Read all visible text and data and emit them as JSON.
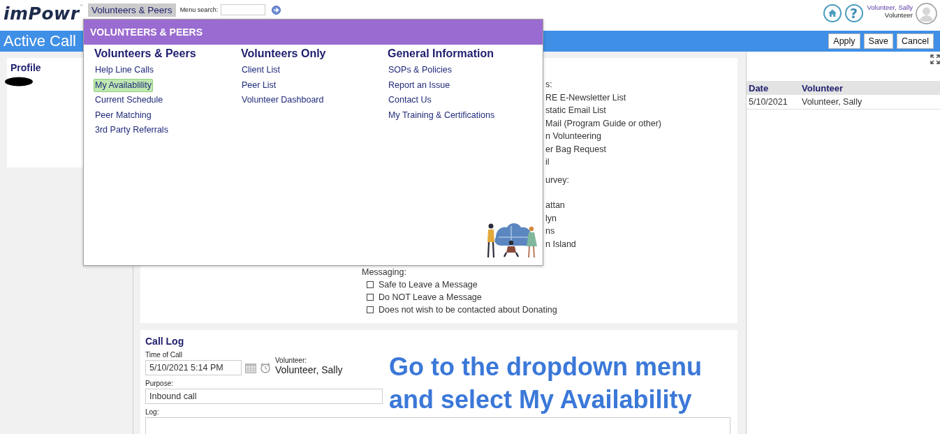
{
  "header": {
    "logo": "imPowr",
    "logo_mark": "™",
    "menu_tabs": [
      {
        "label": "Volunteers & Peers",
        "selected": true
      }
    ],
    "menu_search": {
      "label": "Menu search:"
    },
    "help": "?",
    "user": {
      "name": "Volunteer, Sally",
      "role": "Volunteer"
    }
  },
  "title_bar": {
    "title": "Active Call",
    "buttons": [
      "Apply",
      "Save",
      "Cancel"
    ]
  },
  "profile": {
    "title": "Profile"
  },
  "form": {
    "lines": [
      {
        "kind": "heading",
        "text": "s:"
      },
      {
        "kind": "option",
        "text": "RE E-Newsletter List"
      },
      {
        "kind": "option",
        "text": "static Email List"
      },
      {
        "kind": "option",
        "text": "Mail (Program Guide or other)"
      },
      {
        "kind": "option",
        "text": "n Volunteering"
      },
      {
        "kind": "option",
        "text": "er Bag Request"
      },
      {
        "kind": "option",
        "text": "il"
      },
      {
        "kind": "heading",
        "text": "urvey:"
      },
      {
        "kind": "option",
        "text": "attan"
      },
      {
        "kind": "option",
        "text": "lyn"
      },
      {
        "kind": "option",
        "text": "ns"
      },
      {
        "kind": "option",
        "text": "n Island"
      }
    ],
    "messaging": {
      "label": "Messaging:",
      "options": [
        {
          "label": "Safe to Leave a Message",
          "checked": false
        },
        {
          "label": "Do NOT Leave a Message",
          "checked": false
        },
        {
          "label": "Does not wish to be contacted about Donating",
          "checked": false
        }
      ]
    }
  },
  "call_log": {
    "title": "Call Log",
    "time_label": "Time of Call",
    "time_value": "5/10/2021 5:14 PM",
    "volunteer_label": "Volunteer:",
    "volunteer_value": "Volunteer, Sally",
    "purpose_label": "Purpose:",
    "purpose_value": "Inbound call",
    "log_label": "Log:"
  },
  "history": {
    "columns": [
      "Date",
      "Volunteer"
    ],
    "rows": [
      [
        "5/10/2021",
        "Volunteer, Sally"
      ]
    ]
  },
  "dropdown": {
    "title": "VOLUNTEERS & PEERS",
    "columns": [
      {
        "heading": "Volunteers & Peers",
        "items": [
          {
            "label": "Help Line Calls",
            "selected": false
          },
          {
            "label": "My Availablility",
            "selected": true
          },
          {
            "label": "Current Schedule",
            "selected": false
          },
          {
            "label": "Peer Matching",
            "selected": false
          },
          {
            "label": "3rd Party Referrals",
            "selected": false
          }
        ]
      },
      {
        "heading": "Volunteers Only",
        "items": [
          {
            "label": "Client List",
            "selected": false
          },
          {
            "label": "Peer List",
            "selected": false
          },
          {
            "label": "Volunteer Dashboard",
            "selected": false
          }
        ]
      },
      {
        "heading": "General Information",
        "items": [
          {
            "label": "SOPs & Policies",
            "selected": false
          },
          {
            "label": "Report an Issue",
            "selected": false
          },
          {
            "label": "Contact Us",
            "selected": false
          },
          {
            "label": "My Training & Certifications",
            "selected": false
          }
        ]
      }
    ]
  },
  "annotation": {
    "lines": [
      "Go to the dropdown menu",
      "and select My Availability"
    ]
  }
}
